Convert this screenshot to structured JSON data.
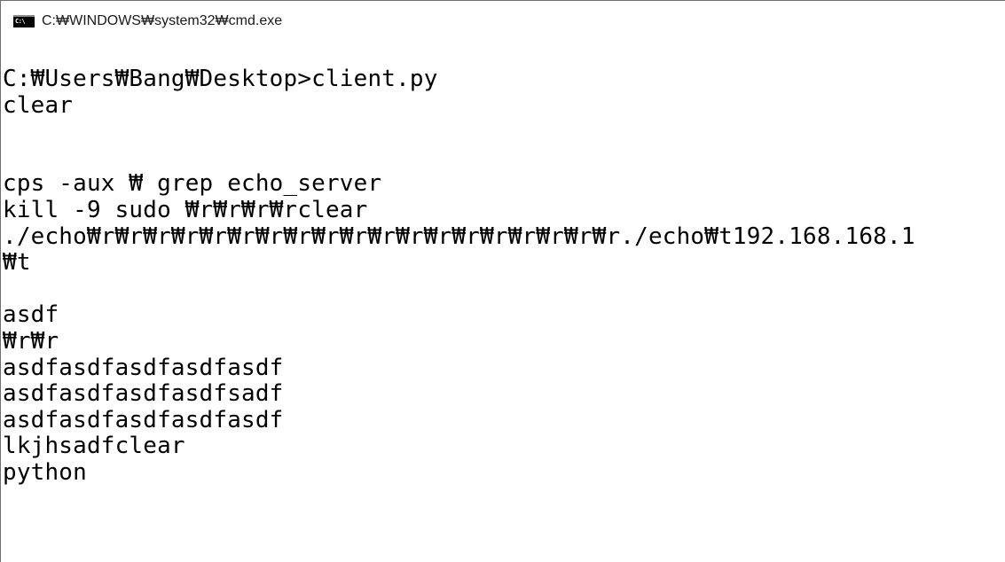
{
  "window": {
    "title": "C:\\WINDOWS\\system32\\cmd.exe",
    "icon": "cmd-icon",
    "icon_label": "C:\\"
  },
  "console": {
    "lines": [
      "",
      "C:\\Users\\Bang\\Desktop>client.py",
      "clear",
      "",
      "",
      "cps -aux \\ grep echo_server",
      "kill -9 sudo \\r\\r\\r\\rclear",
      "./echo\\r\\r\\r\\r\\r\\r\\r\\r\\r\\r\\r\\r\\r\\r\\r\\r\\r\\r\\r./echo\\t192.168.168.1",
      "\\t",
      "",
      "asdf",
      "\\r\\r",
      "asdfasdfasdfasdfasdf",
      "asdfasdfasdfasdfsadf",
      "asdfasdfasdfasdfasdf",
      "lkjhsadfclear",
      "python"
    ]
  }
}
